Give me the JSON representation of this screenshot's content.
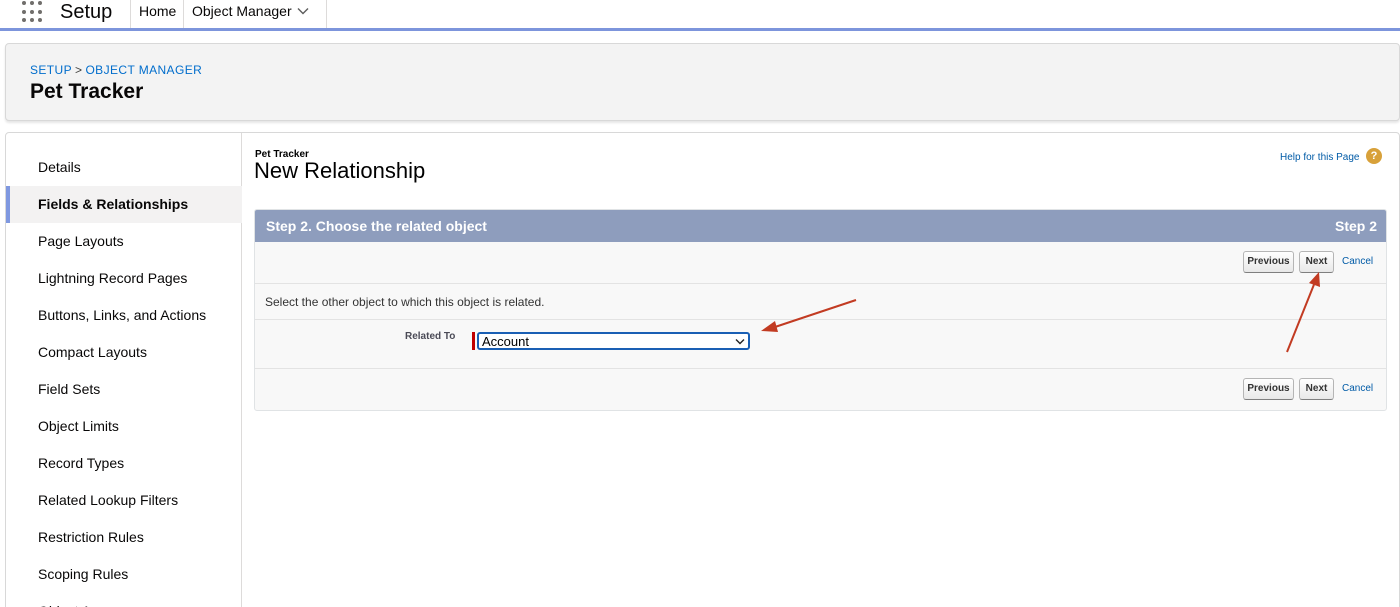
{
  "header": {
    "app_launcher_icon": "grid-icon",
    "app_name": "Setup",
    "nav": {
      "home": "Home",
      "object_manager_tab": "Object Manager",
      "tab_chevron_icon": "chevron-down-icon"
    },
    "accent_color": "#7d95dc"
  },
  "page_header": {
    "breadcrumb": [
      "SETUP",
      "OBJECT MANAGER"
    ],
    "breadcrumb_separator": ">",
    "title": "Pet Tracker"
  },
  "sidebar": {
    "items": [
      {
        "label": "Details",
        "active": false
      },
      {
        "label": "Fields & Relationships",
        "active": true
      },
      {
        "label": "Page Layouts",
        "active": false
      },
      {
        "label": "Lightning Record Pages",
        "active": false
      },
      {
        "label": "Buttons, Links, and Actions",
        "active": false
      },
      {
        "label": "Compact Layouts",
        "active": false
      },
      {
        "label": "Field Sets",
        "active": false
      },
      {
        "label": "Object Limits",
        "active": false
      },
      {
        "label": "Record Types",
        "active": false
      },
      {
        "label": "Related Lookup Filters",
        "active": false
      },
      {
        "label": "Restriction Rules",
        "active": false
      },
      {
        "label": "Scoping Rules",
        "active": false
      },
      {
        "label": "Object Access",
        "active": false
      }
    ]
  },
  "main": {
    "object_label": "Pet Tracker",
    "heading": "New Relationship",
    "help_link": "Help for this Page",
    "help_icon": "question-icon",
    "step_bar": {
      "title": "Step 2. Choose the related object",
      "step_number": "Step 2",
      "color": "#8e9dbd"
    },
    "buttons": {
      "previous": "Previous",
      "next": "Next",
      "cancel": "Cancel"
    },
    "instruction": "Select the other object to which this object is related.",
    "field": {
      "label": "Related To",
      "selected_value": "Account",
      "required": true,
      "required_color": "#c00000"
    }
  },
  "annotations": {
    "arrow_color": "#c23b22",
    "arrows": [
      "arrow-to-related-select",
      "arrow-to-next-button"
    ]
  }
}
